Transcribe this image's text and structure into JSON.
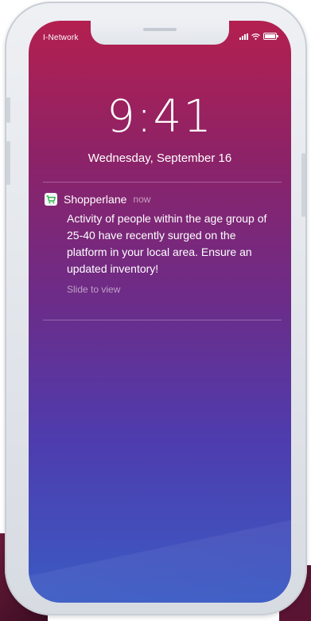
{
  "status_bar": {
    "carrier": "I-Network",
    "signal_icon": "signal-bars-icon",
    "wifi_icon": "wifi-icon",
    "battery_icon": "battery-icon"
  },
  "lock_screen": {
    "time": "9:41",
    "date": "Wednesday, September 16"
  },
  "notification": {
    "app_icon": "shopping-cart-icon",
    "app_name": "Shopperlane",
    "time": "now",
    "message": "Activity of people within the age group of 25-40 have recently surged on the platform in your local area. Ensure an updated inventory!",
    "hint": "Slide to view"
  },
  "colors": {
    "gradient_top": "#b3204f",
    "gradient_mid": "#6c2c88",
    "gradient_bottom": "#3a5bc4",
    "app_icon_accent": "#2db34a"
  }
}
